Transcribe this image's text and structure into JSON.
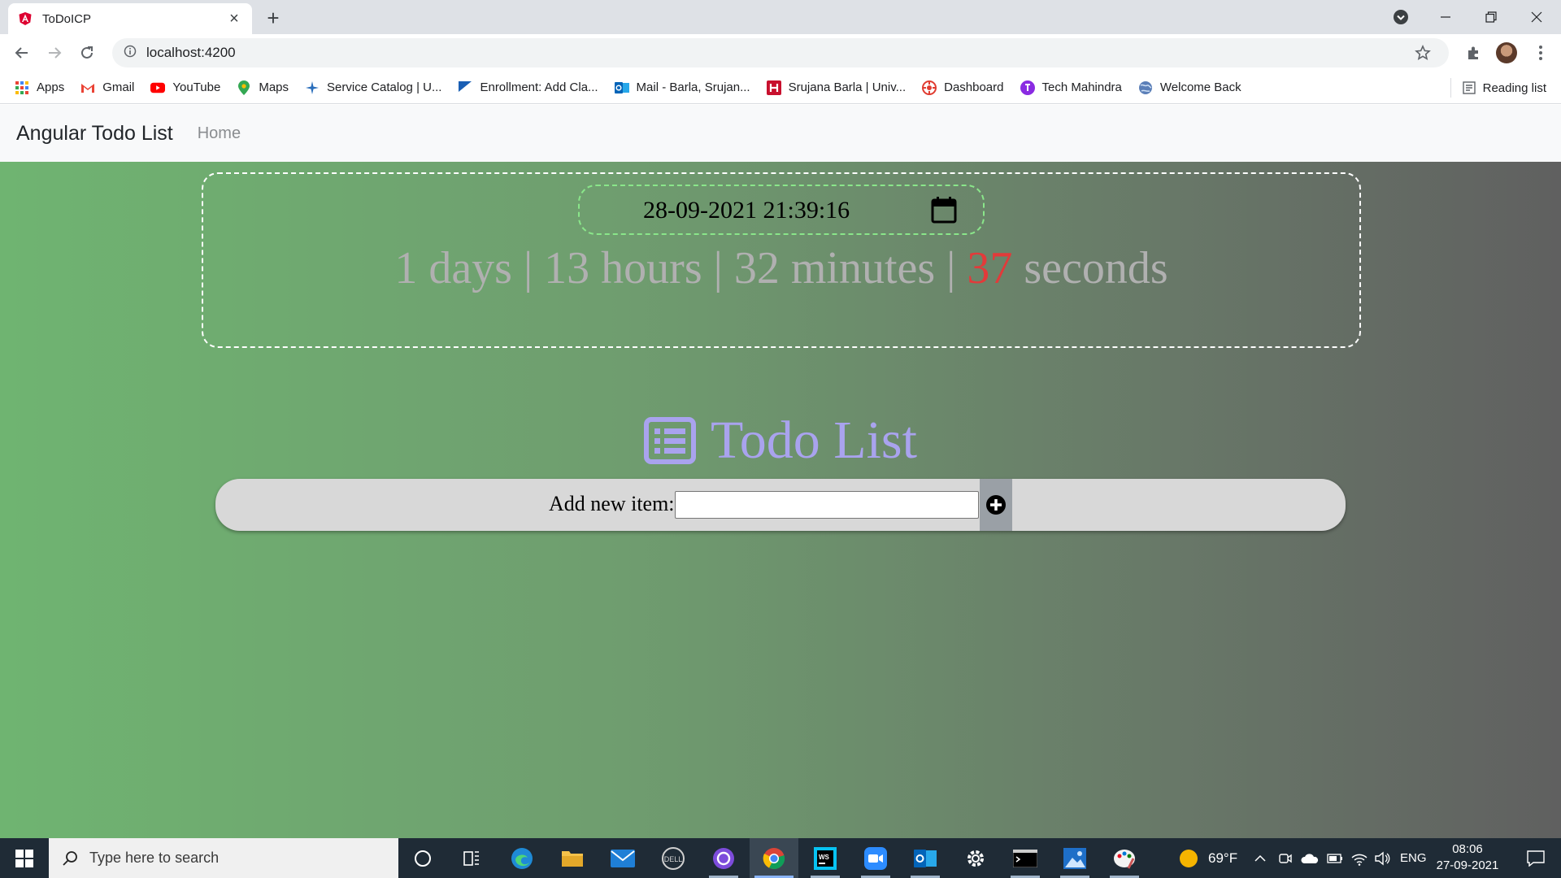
{
  "browser": {
    "tab_title": "ToDoICP",
    "url": "localhost:4200",
    "bookmarks": [
      {
        "label": "Apps",
        "icon": "apps-grid-icon"
      },
      {
        "label": "Gmail",
        "icon": "gmail-icon"
      },
      {
        "label": "YouTube",
        "icon": "youtube-icon"
      },
      {
        "label": "Maps",
        "icon": "maps-icon"
      },
      {
        "label": "Service Catalog | U...",
        "icon": "service-catalog-icon"
      },
      {
        "label": "Enrollment: Add Cla...",
        "icon": "enrollment-icon"
      },
      {
        "label": "Mail - Barla, Srujan...",
        "icon": "outlook-icon"
      },
      {
        "label": "Srujana Barla | Univ...",
        "icon": "university-icon"
      },
      {
        "label": "Dashboard",
        "icon": "dashboard-icon"
      },
      {
        "label": "Tech Mahindra",
        "icon": "tech-mahindra-icon"
      },
      {
        "label": "Welcome Back",
        "icon": "globe-icon"
      }
    ],
    "reading_list": "Reading list"
  },
  "app": {
    "brand": "Angular Todo List",
    "nav_home": "Home",
    "date_value": "28-09-2021 21:39:16",
    "countdown": {
      "days": "1 days |",
      "hours": "13 hours |",
      "minutes": "32 minutes |",
      "seconds_num": "37",
      "seconds_label": "seconds"
    },
    "todo_title": "Todo List",
    "add_label": "Add new item:",
    "add_value": ""
  },
  "taskbar": {
    "search_placeholder": "Type here to search",
    "weather": "69°F",
    "language": "ENG",
    "time": "08:06",
    "date": "27-09-2021"
  },
  "colors": {
    "accent_seconds": "#e23a3a",
    "todo_title": "#a9a3ee",
    "gradient_start": "#6fb471",
    "gradient_end": "#606060"
  }
}
